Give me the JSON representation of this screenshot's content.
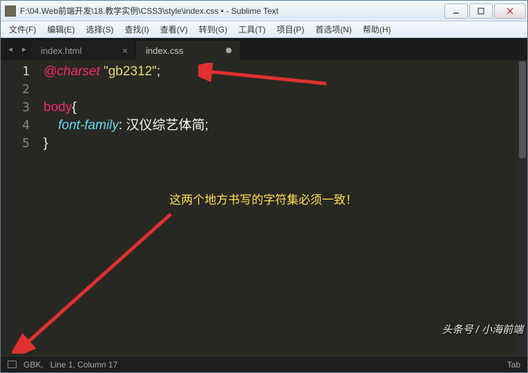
{
  "title": "F:\\04.Web前端开发\\18.教学实例\\CSS3\\style\\index.css • - Sublime Text",
  "menu": [
    {
      "label": "文件(F)"
    },
    {
      "label": "编辑(E)"
    },
    {
      "label": "选择(S)"
    },
    {
      "label": "查找(I)"
    },
    {
      "label": "查看(V)"
    },
    {
      "label": "转到(G)"
    },
    {
      "label": "工具(T)"
    },
    {
      "label": "项目(P)"
    },
    {
      "label": "首选项(N)"
    },
    {
      "label": "帮助(H)"
    }
  ],
  "tabs": [
    {
      "label": "index.html",
      "dirty": false,
      "active": false
    },
    {
      "label": "index.css",
      "dirty": true,
      "active": true
    }
  ],
  "code": {
    "line1_at": "@charset ",
    "line1_str": "\"gb2312\"",
    "line1_semi": ";",
    "line3_sel": "body",
    "line3_brace": "{",
    "line4_indent": "    ",
    "line4_prop": "font-family",
    "line4_colon": ": ",
    "line4_val": "汉仪综艺体简",
    "line4_semi": ";",
    "line5_brace": "}"
  },
  "line_numbers": [
    "1",
    "2",
    "3",
    "4",
    "5"
  ],
  "annotation": "这两个地方书写的字符集必须一致！",
  "status": {
    "encoding": "GBK,",
    "pos": "Line 1, Column 17",
    "tab": "Tab"
  },
  "watermark": "头条号 / 小海前端"
}
